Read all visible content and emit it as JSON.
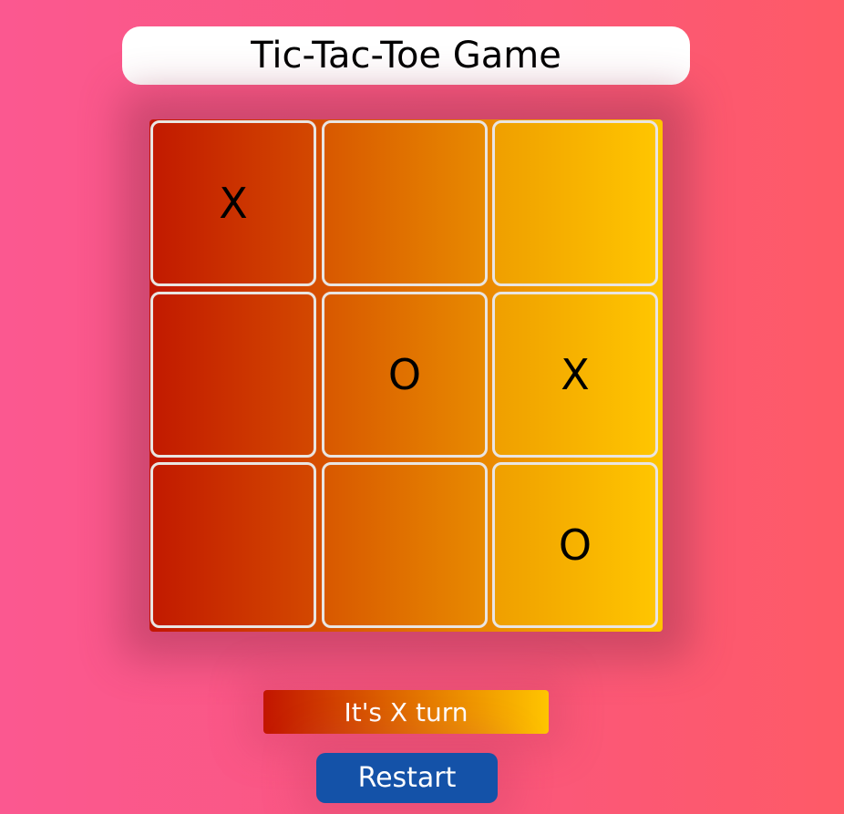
{
  "header": {
    "title": "Tic-Tac-Toe Game"
  },
  "board": {
    "cells": [
      [
        "X",
        "",
        ""
      ],
      [
        "",
        "O",
        "X"
      ],
      [
        "",
        "",
        "O"
      ]
    ]
  },
  "status": {
    "text": "It's X turn"
  },
  "controls": {
    "restart_label": "Restart"
  },
  "colors": {
    "background_left": "#fb5890",
    "background_right": "#fe5a67",
    "board_gradient_start": "#c21500",
    "board_gradient_end": "#ffc500",
    "cell_border": "#e9e5e2",
    "restart_button": "#1452a8"
  }
}
